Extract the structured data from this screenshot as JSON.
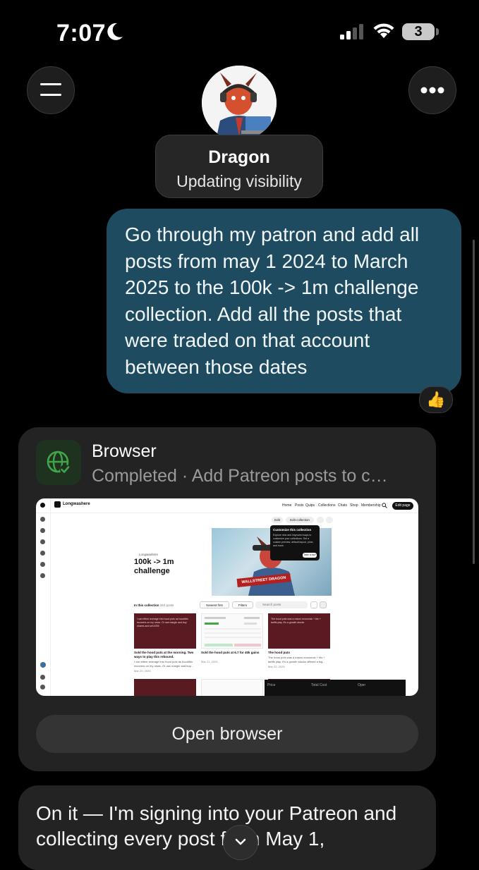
{
  "status_bar": {
    "time": "7:07",
    "battery": "3"
  },
  "header": {
    "agent_name": "Dragon",
    "agent_status": "Updating visibility"
  },
  "user_message": {
    "text": "Go through my patron and add all posts from may 1 2024 to March 2025 to the 100k -> 1m challenge collection. Add all the posts that were traded on that account between those dates",
    "reaction": "👍"
  },
  "browser_card": {
    "title": "Browser",
    "subtitle": "Completed · Add Patreon posts to c…",
    "open_label": "Open browser",
    "icon": "globe-check-icon",
    "accent": "#3fa64a",
    "screenshot": {
      "brand": "Longwashere",
      "nav": [
        "Home",
        "Posts",
        "Quips",
        "Collections",
        "Chats",
        "Shop",
        "Membership"
      ],
      "edit_page": "Edit page",
      "edit": "Edit",
      "edit_collection": "Edit collection",
      "creator": "Longwashere",
      "collection_title": "100k -> 1m challenge",
      "banner": "WALLSTREET DRAGON",
      "tooltip_title": "Customize this collection",
      "tooltip_text": "Explore new and improved ways to customize your collections. Set a custom preview, default layout, price, and more.",
      "tooltip_button": "Take a tour",
      "in_collection": "In this collection",
      "post_count": "344 posts",
      "sort": "Newest first",
      "filters": "Filters",
      "search_placeholder": "Search posts",
      "posts": [
        {
          "preview": "I can either average into hood puts as hood/btc recovers on my news. Or use margin and buy shares and sell ATM",
          "title": "Sold the hood puts at the morning. Two ways to play this rebound.",
          "body": "I can either average into hood puts as hood/btc recovers on my news. Or use margin and buy...",
          "date": "Mar 20, 2025"
        },
        {
          "title": "Sold the hood puts at 6.7 for 40k gains",
          "date": "Mar 21, 2025"
        },
        {
          "preview": "The hood puts was a macro economic + btc + tariffs play. It's a growth stocks",
          "title": "The hood puts",
          "body": "The hood puts was a macro economic + btc + tariffs play. It's a growth stocks offered a big...",
          "date": "Mar 20, 2025"
        }
      ],
      "table_headers": [
        "Price",
        "Total Cost",
        "Oper"
      ]
    }
  },
  "assistant_message": {
    "text": "On it — I'm signing into your Patreon and collecting every post from May 1,"
  },
  "colors": {
    "user_bubble": "#1e4b60",
    "card": "#232323",
    "background": "#000000"
  }
}
